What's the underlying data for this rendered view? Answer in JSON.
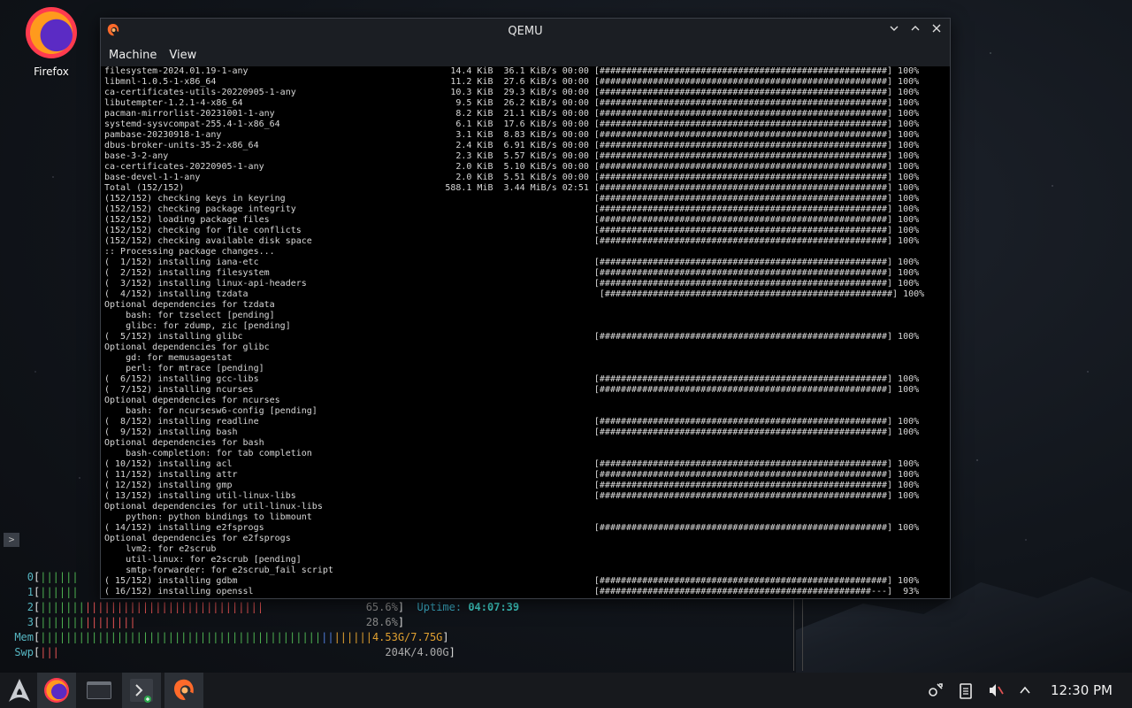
{
  "desktop": {
    "icon_label": "Firefox"
  },
  "window": {
    "title": "QEMU",
    "menu": [
      "Machine",
      "View"
    ],
    "terminal_lines": [
      "filesystem-2024.01.19-1-any                                      14.4 KiB  36.1 KiB/s 00:00 [######################################################] 100%",
      "libmnl-1.0.5-1-x86_64                                            11.2 KiB  27.6 KiB/s 00:00 [######################################################] 100%",
      "ca-certificates-utils-20220905-1-any                             10.3 KiB  29.3 KiB/s 00:00 [######################################################] 100%",
      "libutempter-1.2.1-4-x86_64                                        9.5 KiB  26.2 KiB/s 00:00 [######################################################] 100%",
      "pacman-mirrorlist-20231001-1-any                                  8.2 KiB  21.1 KiB/s 00:00 [######################################################] 100%",
      "systemd-sysvcompat-255.4-1-x86_64                                 6.1 KiB  17.6 KiB/s 00:00 [######################################################] 100%",
      "pambase-20230918-1-any                                            3.1 KiB  8.83 KiB/s 00:00 [######################################################] 100%",
      "dbus-broker-units-35-2-x86_64                                     2.4 KiB  6.91 KiB/s 00:00 [######################################################] 100%",
      "base-3-2-any                                                      2.3 KiB  5.57 KiB/s 00:00 [######################################################] 100%",
      "ca-certificates-20220905-1-any                                    2.0 KiB  5.10 KiB/s 00:00 [######################################################] 100%",
      "base-devel-1-1-any                                                2.0 KiB  5.51 KiB/s 00:00 [######################################################] 100%",
      "Total (152/152)                                                 588.1 MiB  3.44 MiB/s 02:51 [######################################################] 100%",
      "(152/152) checking keys in keyring                                                          [######################################################] 100%",
      "(152/152) checking package integrity                                                        [######################################################] 100%",
      "(152/152) loading package files                                                             [######################################################] 100%",
      "(152/152) checking for file conflicts                                                       [######################################################] 100%",
      "(152/152) checking available disk space                                                     [######################################################] 100%",
      ":: Processing package changes...",
      "(  1/152) installing iana-etc                                                               [######################################################] 100%",
      "(  2/152) installing filesystem                                                             [######################################################] 100%",
      "(  3/152) installing linux-api-headers                                                      [######################################################] 100%",
      "(  4/152) installing tzdata                                                                  [######################################################] 100%",
      "Optional dependencies for tzdata",
      "    bash: for tzselect [pending]",
      "    glibc: for zdump, zic [pending]",
      "(  5/152) installing glibc                                                                  [######################################################] 100%",
      "Optional dependencies for glibc",
      "    gd: for memusagestat",
      "    perl: for mtrace [pending]",
      "(  6/152) installing gcc-libs                                                               [######################################################] 100%",
      "(  7/152) installing ncurses                                                                [######################################################] 100%",
      "Optional dependencies for ncurses",
      "    bash: for ncursesw6-config [pending]",
      "(  8/152) installing readline                                                               [######################################################] 100%",
      "(  9/152) installing bash                                                                   [######################################################] 100%",
      "Optional dependencies for bash",
      "    bash-completion: for tab completion",
      "( 10/152) installing acl                                                                    [######################################################] 100%",
      "( 11/152) installing attr                                                                   [######################################################] 100%",
      "( 12/152) installing gmp                                                                    [######################################################] 100%",
      "( 13/152) installing util-linux-libs                                                        [######################################################] 100%",
      "Optional dependencies for util-linux-libs",
      "    python: python bindings to libmount",
      "( 14/152) installing e2fsprogs                                                              [######################################################] 100%",
      "Optional dependencies for e2fsprogs",
      "    lvm2: for e2scrub",
      "    util-linux: for e2scrub [pending]",
      "    smtp-forwarder: for e2scrub_fail script",
      "( 15/152) installing gdbm                                                                   [######################################################] 100%",
      "( 16/152) installing openssl                                                                [###################################################---]  93%"
    ]
  },
  "htop": {
    "expand_glyph": ">",
    "cpu2_pct": "65.6%",
    "cpu3_pct": "28.6%",
    "uptime_label": "Uptime:",
    "uptime_value": "04:07:39",
    "mem_value": "4.53G/7.75G",
    "swp_value": "204K/4.00G",
    "labels": {
      "c0": "0",
      "c1": "1",
      "c2": "2",
      "c3": "3",
      "mem": "Mem",
      "swp": "Swp"
    }
  },
  "taskbar": {
    "clock": "12:30 PM"
  },
  "colors": {
    "accent": "#4caf50",
    "terminal_bg": "#000000",
    "taskbar_bg": "#17191d"
  }
}
